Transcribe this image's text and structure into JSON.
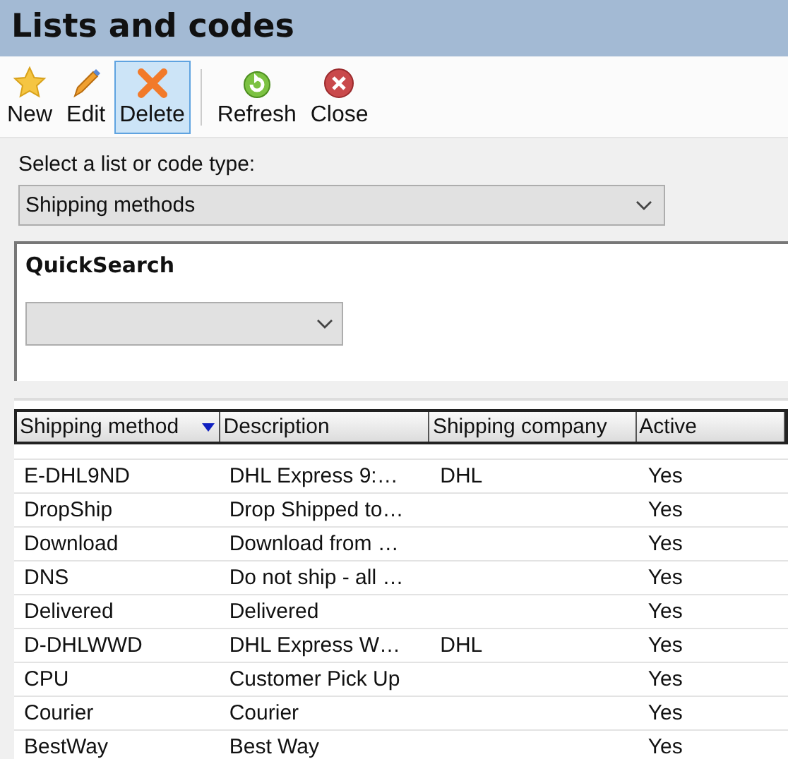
{
  "window": {
    "title": "Lists and codes"
  },
  "toolbar": [
    {
      "kind": "new",
      "label": "New",
      "selected": false
    },
    {
      "kind": "edit",
      "label": "Edit",
      "selected": false
    },
    {
      "kind": "delete",
      "label": "Delete",
      "selected": true
    },
    {
      "kind": "refresh",
      "label": "Refresh",
      "selected": false
    },
    {
      "kind": "close",
      "label": "Close",
      "selected": false
    }
  ],
  "list_type": {
    "label": "Select a list or code type:",
    "value": "Shipping methods"
  },
  "quick_search": {
    "title": "QuickSearch"
  },
  "table": {
    "columns": [
      {
        "label": "Shipping method",
        "sorted": true
      },
      {
        "label": "Description",
        "sorted": false
      },
      {
        "label": "Shipping company",
        "sorted": false
      },
      {
        "label": "Active",
        "sorted": false
      }
    ],
    "rows": [
      [
        "E-DHL9ND",
        "DHL Express 9:…",
        "DHL",
        "Yes"
      ],
      [
        "DropShip",
        "Drop Shipped to…",
        "",
        "Yes"
      ],
      [
        "Download",
        "Download from …",
        "",
        "Yes"
      ],
      [
        "DNS",
        "Do not ship - all …",
        "",
        "Yes"
      ],
      [
        "Delivered",
        "Delivered",
        "",
        "Yes"
      ],
      [
        "D-DHLWWD",
        "DHL Express W…",
        "DHL",
        "Yes"
      ],
      [
        "CPU",
        "Customer Pick Up",
        "",
        "Yes"
      ],
      [
        "Courier",
        "Courier",
        "",
        "Yes"
      ],
      [
        "BestWay",
        "Best Way",
        "",
        "Yes"
      ]
    ]
  }
}
